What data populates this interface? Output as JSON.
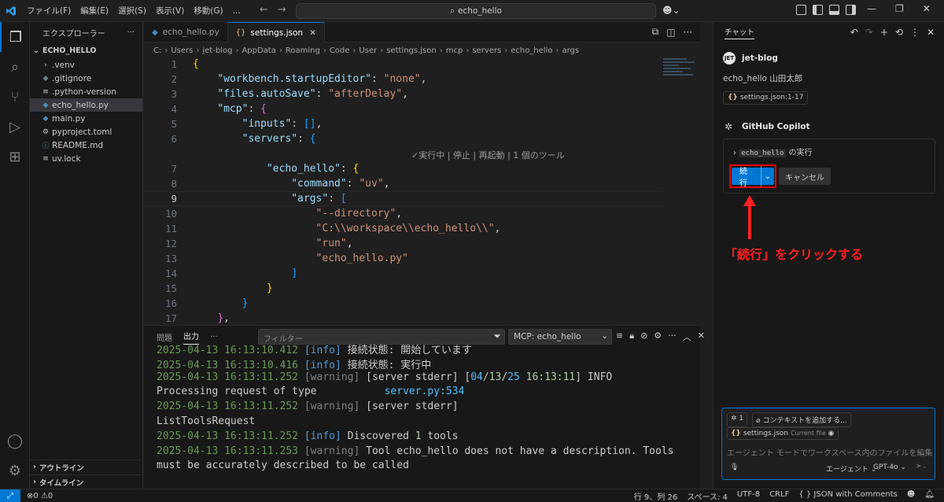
{
  "titlebar": {
    "menus": [
      "ファイル(F)",
      "編集(E)",
      "選択(S)",
      "表示(V)",
      "移動(G)",
      "..."
    ],
    "search": "echo_hello"
  },
  "explorer": {
    "header": "エクスプローラー",
    "header_more": "···",
    "folder": "ECHO_HELLO",
    "files": [
      ".venv",
      ".gitignore",
      ".python-version",
      "echo_hello.py",
      "main.py",
      "pyproject.toml",
      "README.md",
      "uv.lock"
    ],
    "outline": "アウトライン",
    "timeline": "タイムライン"
  },
  "tabs": [
    {
      "label": "echo_hello.py"
    },
    {
      "label": "settings.json"
    }
  ],
  "breadcrumb": [
    "C:",
    "Users",
    "jet-blog",
    "AppData",
    "Roaming",
    "Code",
    "User",
    "settings.json",
    "mcp",
    "servers",
    "echo_hello",
    "args"
  ],
  "code": {
    "codelens": "✓実行中 | 停止 | 再起動 | 1 個のツール",
    "lines": [
      {
        "n": "1",
        "t": "{"
      },
      {
        "n": "2",
        "t": "    \"workbench.startupEditor\": \"none\","
      },
      {
        "n": "3",
        "t": "    \"files.autoSave\": \"afterDelay\","
      },
      {
        "n": "4",
        "t": "    \"mcp\": {"
      },
      {
        "n": "5",
        "t": "        \"inputs\": [],"
      },
      {
        "n": "6",
        "t": "        \"servers\": {"
      },
      {
        "n": "7",
        "t": "            \"echo_hello\": {"
      },
      {
        "n": "8",
        "t": "                \"command\": \"uv\","
      },
      {
        "n": "9",
        "t": "                \"args\": ["
      },
      {
        "n": "10",
        "t": "                    \"--directory\","
      },
      {
        "n": "11",
        "t": "                    \"C:\\\\workspace\\\\echo_hello\\\\\","
      },
      {
        "n": "12",
        "t": "                    \"run\","
      },
      {
        "n": "13",
        "t": "                    \"echo_hello.py\""
      },
      {
        "n": "14",
        "t": "                ]"
      },
      {
        "n": "15",
        "t": "            }"
      },
      {
        "n": "16",
        "t": "        }"
      },
      {
        "n": "17",
        "t": "    },"
      }
    ]
  },
  "panel": {
    "tab_problems": "問題",
    "tab_output": "出力",
    "more": "···",
    "filter_placeholder": "フィルター",
    "channel": "MCP: echo_hello",
    "output": [
      "2025-04-13 16:13:10.412 [info] 接続状態: 開始しています",
      "2025-04-13 16:13:10.416 [info] 接続状態: 実行中",
      "2025-04-13 16:13:11.252 [warning] [server stderr] [04/13/25 16:13:11] INFO",
      "Processing request of type           server.py:534",
      "2025-04-13 16:13:11.252 [warning] [server stderr]",
      "ListToolsRequest",
      "2025-04-13 16:13:11.252 [info] Discovered 1 tools",
      "2025-04-13 16:13:11.253 [warning] Tool echo_hello does not have a description. Tools",
      "must be accurately described to be called"
    ]
  },
  "chat": {
    "title": "チャット",
    "user_name": "jet-blog",
    "user_avatar": "JET",
    "user_message": "echo_hello 山田太郎",
    "reference": "settings.json:1-17",
    "assistant_name": "GitHub Copilot",
    "tool_prefix": "echo_hello",
    "tool_suffix": " の実行",
    "continue_label": "続行",
    "cancel_label": "キャンセル",
    "annotation": "「続行」をクリックする",
    "input": {
      "tools_count": "1",
      "add_context": "コンテキストを追加する...",
      "file_chip": "settings.json",
      "current_file": "Current file",
      "placeholder": "エージェント モードでワークスペース内のファイルを編集",
      "mode": "エージェント",
      "model": "GPT-4o"
    }
  },
  "status": {
    "errors": "0",
    "warnings": "0",
    "position": "行 9、列 26",
    "spaces": "スペース: 4",
    "encoding": "UTF-8",
    "eol": "CRLF",
    "language": "JSON with Comments"
  },
  "colors": {
    "accent": "#0078d4",
    "annotation": "#ff2020"
  }
}
